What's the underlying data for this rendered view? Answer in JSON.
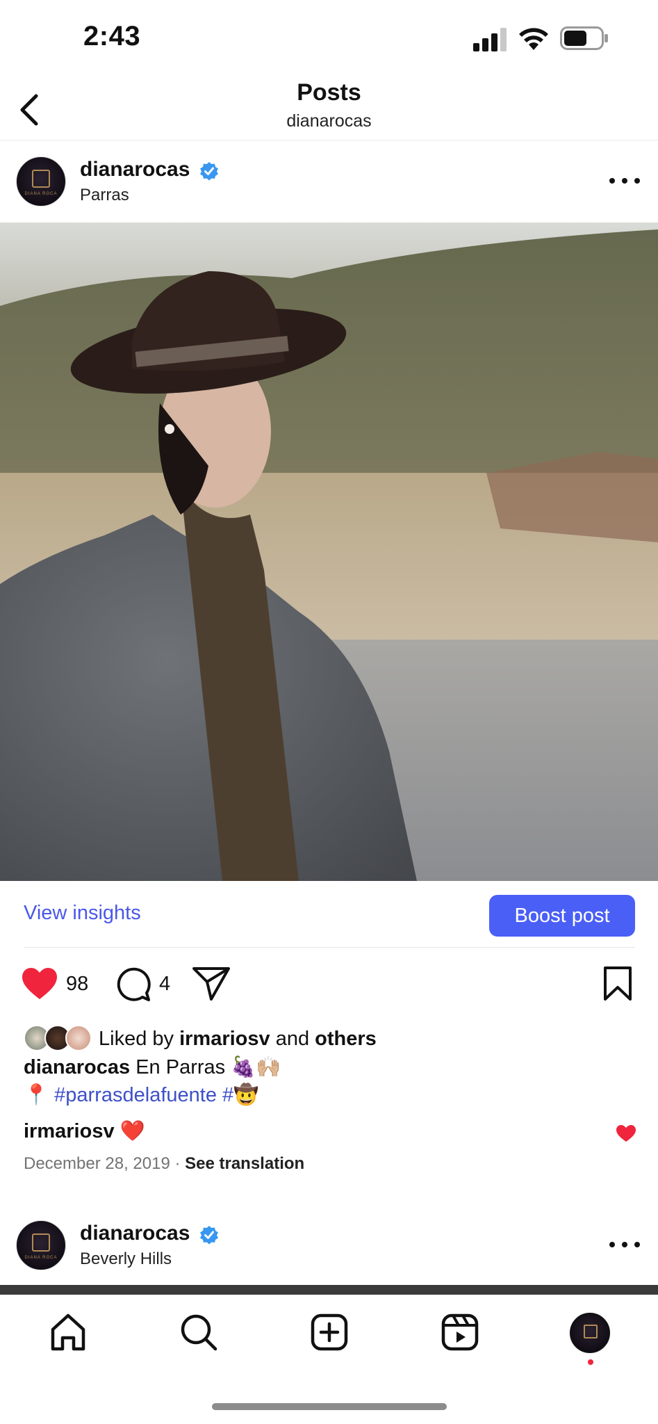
{
  "status_bar": {
    "time": "2:43"
  },
  "header": {
    "title": "Posts",
    "subtitle": "dianarocas"
  },
  "post": {
    "username": "dianarocas",
    "location": "Parras",
    "view_insights_label": "View insights",
    "boost_label": "Boost post",
    "like_count": "98",
    "comment_count": "4",
    "liked_by_prefix": "Liked by ",
    "liked_by_user": "irmariosv",
    "liked_by_mid": " and ",
    "liked_by_others": "others",
    "caption_user": "dianarocas",
    "caption_text": " En Parras 🍇🙌🏼",
    "caption_pin": "📍",
    "hashtag_1": "#parrasdelafuente",
    "hashtag_2": "#",
    "caption_emoji_end": "🤠",
    "comment_user": "irmariosv",
    "comment_text": " ❤️",
    "date": "December 28, 2019",
    "separator": " · ",
    "see_translation": "See translation"
  },
  "next_post": {
    "username": "dianarocas",
    "location": "Beverly Hills"
  },
  "colors": {
    "accent": "#4a5ff5",
    "link": "#4a58e8",
    "like_red": "#f0243d",
    "verified": "#3897f0"
  },
  "icons": [
    "back-icon",
    "more-icon",
    "heart-icon",
    "comment-icon",
    "share-icon",
    "bookmark-icon",
    "home-icon",
    "search-icon",
    "create-icon",
    "reels-icon"
  ]
}
